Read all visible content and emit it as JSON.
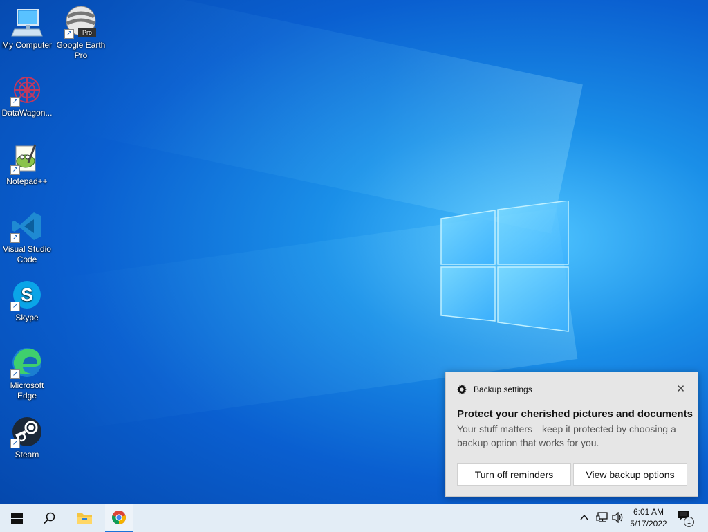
{
  "desktop": {
    "icons": [
      {
        "label": "My Computer"
      },
      {
        "label": "Google Earth Pro",
        "badge": "Pro"
      },
      {
        "label": "DataWagon..."
      },
      {
        "label": "Notepad++"
      },
      {
        "label": "Visual Studio Code"
      },
      {
        "label": "Skype"
      },
      {
        "label": "Microsoft Edge"
      },
      {
        "label": "Steam"
      }
    ]
  },
  "toast": {
    "app_name": "Backup settings",
    "close_glyph": "✕",
    "title": "Protect your cherished pictures and documents",
    "body": "Your stuff matters—keep it protected by choosing a backup option that works for you.",
    "button_1": "Turn off reminders",
    "button_2": "View backup options"
  },
  "taskbar": {
    "items": [
      "start-icon",
      "search-icon",
      "file-explorer-icon",
      "chrome-icon"
    ],
    "clock_time": "6:01 AM",
    "clock_date": "5/17/2022",
    "notification_count": "1"
  },
  "colors": {
    "wallpaper": "#0a5fd0",
    "taskbar": "#e3edf6",
    "accent": "#1a73d9"
  }
}
